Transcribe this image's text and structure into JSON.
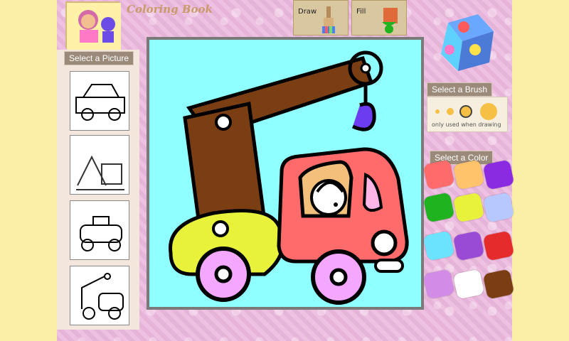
{
  "app": {
    "title": "Coloring Book"
  },
  "toolbar": {
    "draw_label": "Draw",
    "fill_label": "Fill"
  },
  "left_panel": {
    "section_label": "Select a Picture"
  },
  "brush": {
    "section_label": "Select a Brush",
    "note": "only used when drawing"
  },
  "colors": {
    "section_label": "Select a Color",
    "swatches": [
      "#ff6b6b",
      "#ffc36b",
      "#8a2be2",
      "#1fb31f",
      "#e8f23b",
      "#b7c8ff",
      "#6be3ff",
      "#9a4bd6",
      "#e52b2b",
      "#d28be6",
      "#ffffff",
      "#7a3e12"
    ]
  },
  "canvas": {
    "background_color": "#90ffff"
  }
}
